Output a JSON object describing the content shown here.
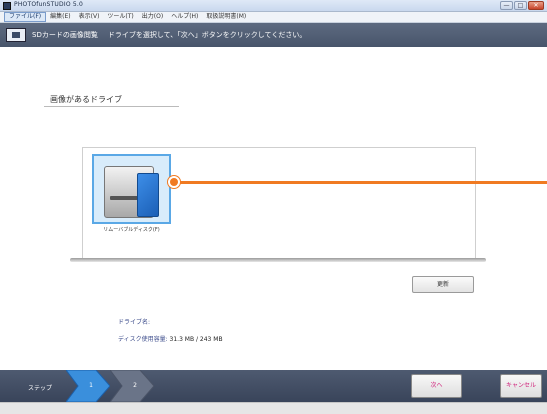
{
  "window": {
    "title": "PHOTOfunSTUDIO 5.0",
    "controls": [
      "—",
      "□",
      "✕"
    ]
  },
  "menu": [
    {
      "label": "ファイル(F)",
      "active": true
    },
    {
      "label": "編集(E)",
      "active": false
    },
    {
      "label": "表示(V)",
      "active": false
    },
    {
      "label": "ツール(T)",
      "active": false
    },
    {
      "label": "出力(O)",
      "active": false
    },
    {
      "label": "ヘルプ(H)",
      "active": false
    },
    {
      "label": "取扱説明書(M)",
      "active": false
    }
  ],
  "header": {
    "title": "SDカードの画像閲覧",
    "description": "ドライブを選択して、「次へ」ボタンをクリックしてください。"
  },
  "section": {
    "title": "画像があるドライブ"
  },
  "drive": {
    "label": "リムーバブルディスク(F)",
    "selected": true
  },
  "refresh_label": "更新",
  "info": {
    "name_label": "ドライブ名:",
    "usage_label": "ディスク使用容量:",
    "usage_value": "31.3 MB / 243 MB"
  },
  "steps": {
    "label": "ステップ",
    "items": [
      "1",
      "2"
    ]
  },
  "buttons": {
    "next": "次へ",
    "cancel": "キャンセル"
  },
  "colors": {
    "accent": "#f07a22",
    "banner": "#48556b",
    "selection": "#5aa8e6",
    "button_text": "#d0207a"
  }
}
